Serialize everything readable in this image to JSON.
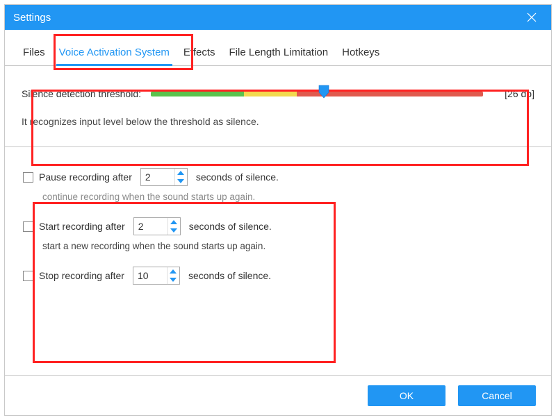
{
  "window": {
    "title": "Settings"
  },
  "tabs": [
    "Files",
    "Voice Activation System",
    "Effects",
    "File Length Limitation",
    "Hotkeys"
  ],
  "activeTab": 1,
  "threshold": {
    "label": "Silence detection threshold:",
    "value_text": "[26 db]",
    "value_db": 26,
    "desc": "It recognizes input level below the threshold as silence."
  },
  "options": {
    "pause": {
      "checked": false,
      "prefix": "Pause recording after",
      "value": "2",
      "suffix": "seconds of silence.",
      "hint": "continue recording when the sound starts up again."
    },
    "start": {
      "checked": false,
      "prefix": "Start recording after",
      "value": "2",
      "suffix": "seconds of silence.",
      "hint": "start a new recording when the sound starts up again."
    },
    "stop": {
      "checked": false,
      "prefix": "Stop recording after",
      "value": "10",
      "suffix": "seconds of silence."
    }
  },
  "buttons": {
    "ok": "OK",
    "cancel": "Cancel"
  }
}
